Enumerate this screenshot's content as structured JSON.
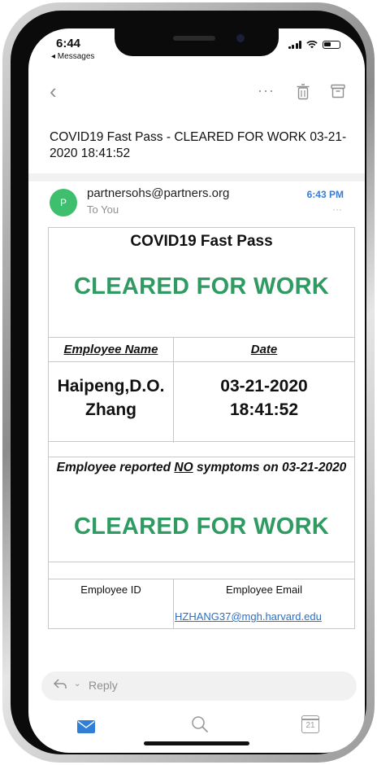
{
  "status": {
    "time": "6:44",
    "back_app": "◂ Messages"
  },
  "toolbar": {
    "back_glyph": "‹",
    "more_glyph": "···"
  },
  "email": {
    "subject": "COVID19 Fast Pass - CLEARED FOR WORK 03-21-2020 18:41:52",
    "avatar_letter": "P",
    "sender": "partnersohs@partners.org",
    "to": "To You",
    "time": "6:43 PM",
    "dots": "···"
  },
  "card": {
    "title": "COVID19 Fast Pass",
    "cleared_1": "CLEARED FOR WORK",
    "employee_name_label": "Employee Name",
    "date_label": "Date",
    "employee_name_line1": "Haipeng,D.O.",
    "employee_name_line2": "Zhang",
    "date_line1": "03-21-2020",
    "date_line2": "18:41:52",
    "report_pre": "Employee reported ",
    "report_no": "NO",
    "report_post": " symptoms on 03-21-2020",
    "cleared_2": "CLEARED FOR WORK",
    "employee_id_label": "Employee ID",
    "employee_email_label": "Employee Email",
    "employee_email": "HZHANG37@mgh.harvard.edu"
  },
  "reply": {
    "placeholder": "Reply",
    "chevron": "⌄"
  },
  "tabbar": {
    "calendar_day": "21"
  },
  "colors": {
    "cleared_green": "#2f9a61",
    "link_blue": "#2a6fc8",
    "accent_blue": "#3a7bd5",
    "avatar_green": "#3dbf6d"
  }
}
